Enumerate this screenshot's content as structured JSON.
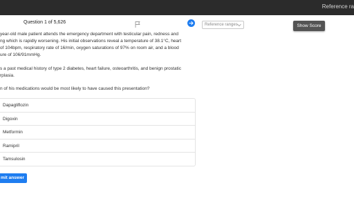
{
  "topbar": {
    "right_text": "Reference ra"
  },
  "question": {
    "counter": "Question 1 of 5,626",
    "stem_lines": [
      "year-old male patient attends the emergency department with testicular pain, redness and",
      "ng which is rapidly worsening. His initial observations reveal a temperature of 38.1°C, heart",
      "of 104bpm, respiratory rate of 16/min, oxygen saturations of 97% on room air, and a blood",
      "ure of 106/91mmHg.",
      "s a past medical history of type 2 diabetes, heart failure, osteoarthritis, and benign prostatic",
      "rplasia.",
      "n of his medications would be most likely to have caused this presentation?"
    ]
  },
  "reference_select": {
    "placeholder": "Reference ranges"
  },
  "show_score": {
    "label": "Show Score"
  },
  "options": [
    {
      "label": "Dapagliflozin"
    },
    {
      "label": "Digoxin"
    },
    {
      "label": "Metformin"
    },
    {
      "label": "Ramipril"
    },
    {
      "label": "Tamsulosin"
    }
  ],
  "submit": {
    "label": "mit answer"
  },
  "icons": {
    "flag": "flag-icon",
    "next": "arrow-right-icon",
    "chevron": "chevron-down-icon"
  },
  "colors": {
    "accent": "#1e7df0",
    "topbar": "#2b2b2b",
    "score_button": "#545454"
  }
}
